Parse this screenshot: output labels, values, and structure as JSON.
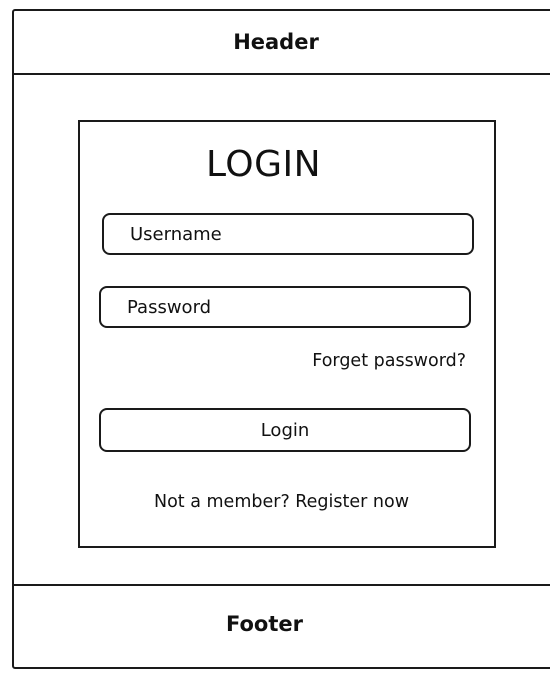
{
  "header": {
    "title": "Header"
  },
  "login": {
    "title": "LOGIN",
    "username_placeholder": "Username",
    "password_placeholder": "Password",
    "forget_password": "Forget password?",
    "login_button": "Login",
    "register_prompt": "Not a member? Register now"
  },
  "footer": {
    "title": "Footer"
  }
}
